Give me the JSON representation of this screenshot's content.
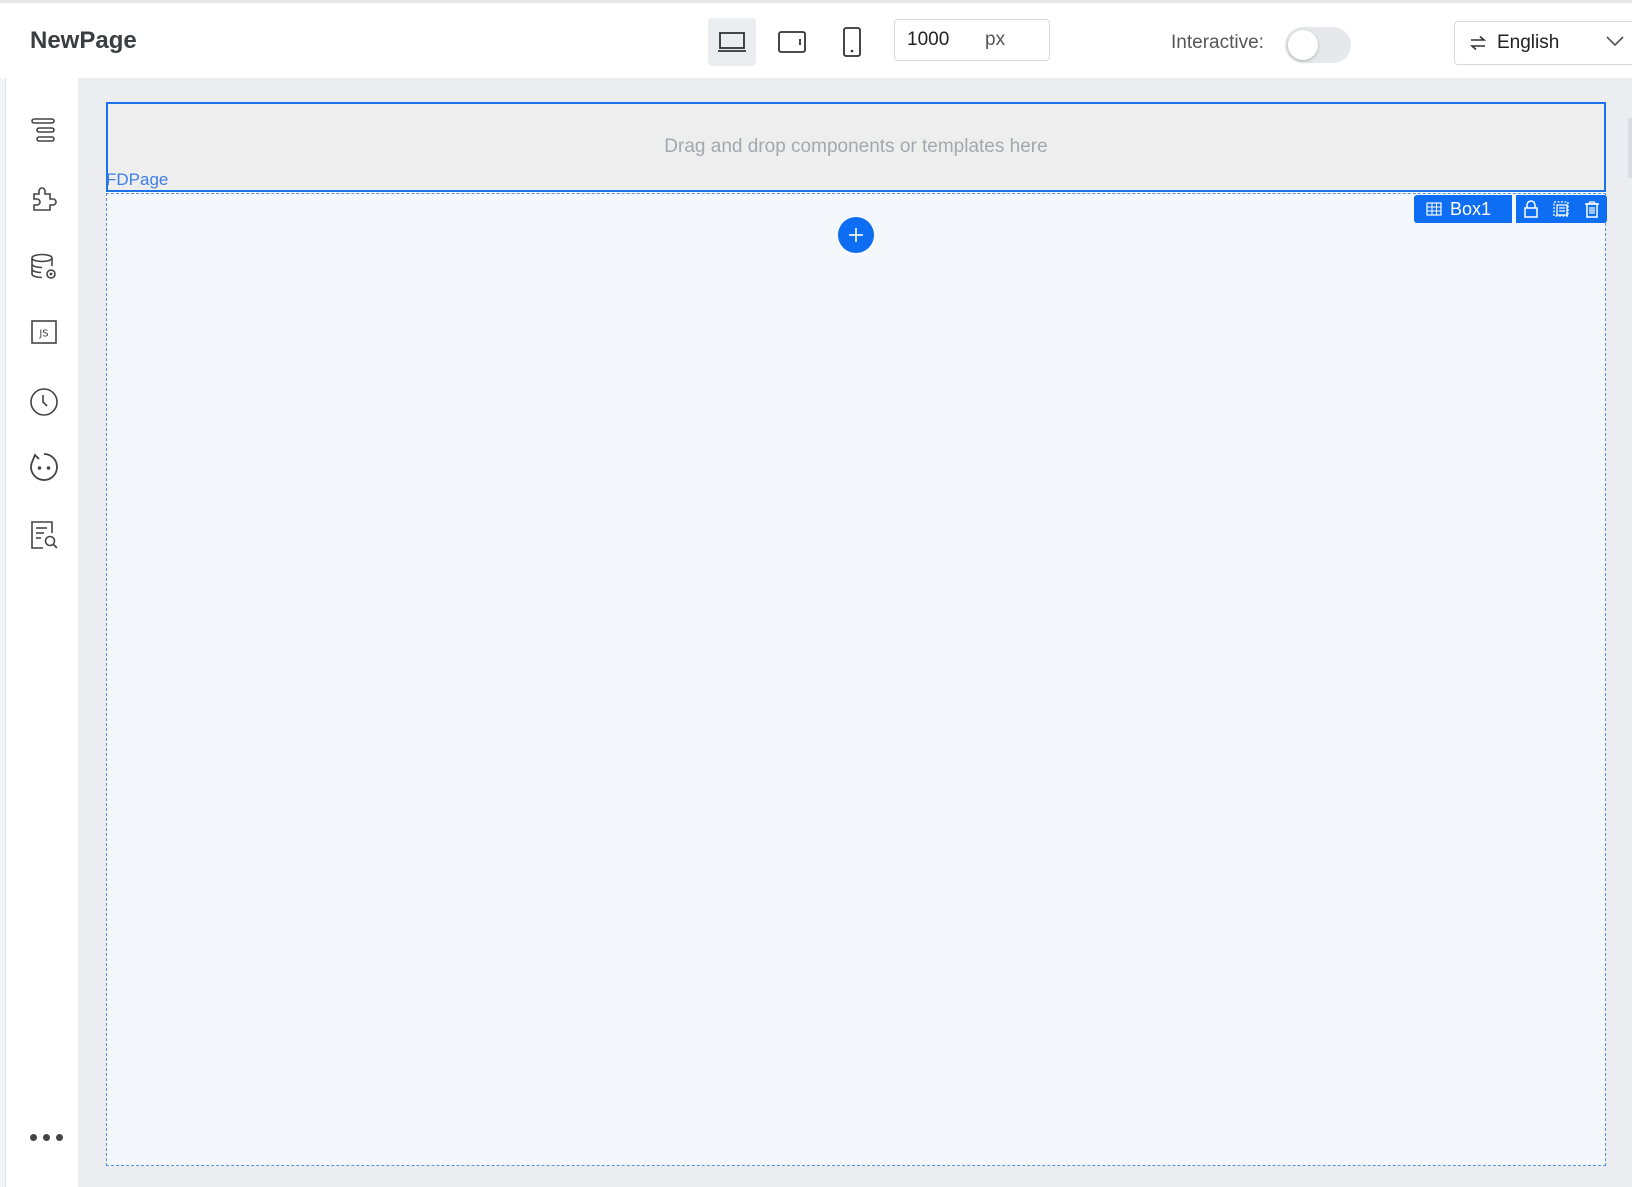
{
  "header": {
    "title": "NewPage",
    "devices": [
      {
        "name": "desktop-icon",
        "active": true
      },
      {
        "name": "tablet-icon",
        "active": false
      },
      {
        "name": "mobile-icon",
        "active": false
      }
    ],
    "width_value": "1000",
    "width_unit": "px",
    "interactive_label": "Interactive:",
    "interactive_on": false,
    "language": "English"
  },
  "sidebar": {
    "items": [
      {
        "icon": "outline-icon"
      },
      {
        "icon": "components-icon"
      },
      {
        "icon": "datasource-icon"
      },
      {
        "icon": "js-icon"
      },
      {
        "icon": "history-icon"
      },
      {
        "icon": "ai-assistant-icon"
      },
      {
        "icon": "page-inspect-icon"
      }
    ],
    "more_icon": "more-icon"
  },
  "canvas": {
    "drop_hint": "Drag and drop components or templates here",
    "page_label": "FDPage",
    "selected_box_label": "Box1",
    "box_actions": [
      "lock-icon",
      "copy-icon",
      "delete-icon"
    ]
  },
  "colors": {
    "accent": "#0d6ef3",
    "canvas_bg": "#ebedf0",
    "box_bg": "#f4f8fc"
  }
}
